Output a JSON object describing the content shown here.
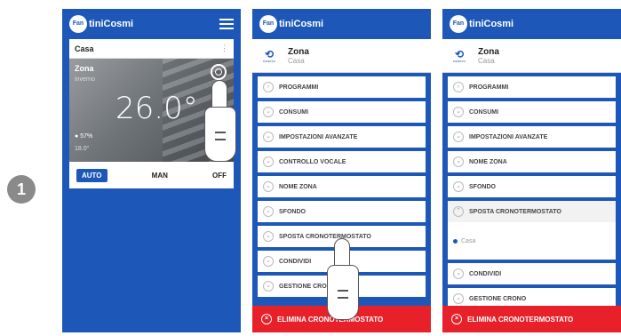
{
  "step_number": "1",
  "logo": {
    "badge": "Fan",
    "text": "tiniCosmi"
  },
  "screen1": {
    "home_name": "Casa",
    "more_label": "⋮",
    "zone": "Zona",
    "season": "inverno",
    "temperature": "26.0°",
    "humidity": "57%",
    "setpoint": "18.0°",
    "modes": [
      "AUTO",
      "MAN",
      "OFF"
    ]
  },
  "screen2": {
    "header_title": "Zona",
    "header_sub": "Casa",
    "back_label": "INDIETRO",
    "menu": [
      {
        "label": "PROGRAMMI",
        "icon": "chevron-right-icon"
      },
      {
        "label": "CONSUMI",
        "icon": "chevron-down-icon"
      },
      {
        "label": "IMPOSTAZIONI AVANZATE",
        "icon": "chevron-down-icon"
      },
      {
        "label": "CONTROLLO VOCALE",
        "icon": "chevron-down-icon"
      },
      {
        "label": "NOME ZONA",
        "icon": "chevron-down-icon"
      },
      {
        "label": "SFONDO",
        "icon": "chevron-down-icon"
      },
      {
        "label": "SPOSTA CRONOTERMOSTATO",
        "icon": "chevron-down-icon"
      },
      {
        "label": "CONDIVIDI",
        "icon": "chevron-down-icon"
      },
      {
        "label": "GESTIONE CRONO",
        "icon": "chevron-down-icon"
      }
    ],
    "delete_label": "ELIMINA CRONOTERMOSTATO"
  },
  "screen3": {
    "header_title": "Zona",
    "header_sub": "Casa",
    "back_label": "INDIETRO",
    "menu": [
      {
        "label": "PROGRAMMI"
      },
      {
        "label": "CONSUMI"
      },
      {
        "label": "IMPOSTAZIONI AVANZATE"
      },
      {
        "label": "NOME ZONA"
      },
      {
        "label": "SFONDO"
      },
      {
        "label": "SPOSTA CRONOTERMOSTATO"
      }
    ],
    "expanded_option": "Casa",
    "menu_after": [
      {
        "label": "CONDIVIDI"
      },
      {
        "label": "GESTIONE CRONO"
      }
    ],
    "delete_label": "ELIMINA CRONOTERMOSTATO"
  },
  "colors": {
    "brand_blue": "#1d58b8",
    "danger_red": "#e8202a"
  }
}
